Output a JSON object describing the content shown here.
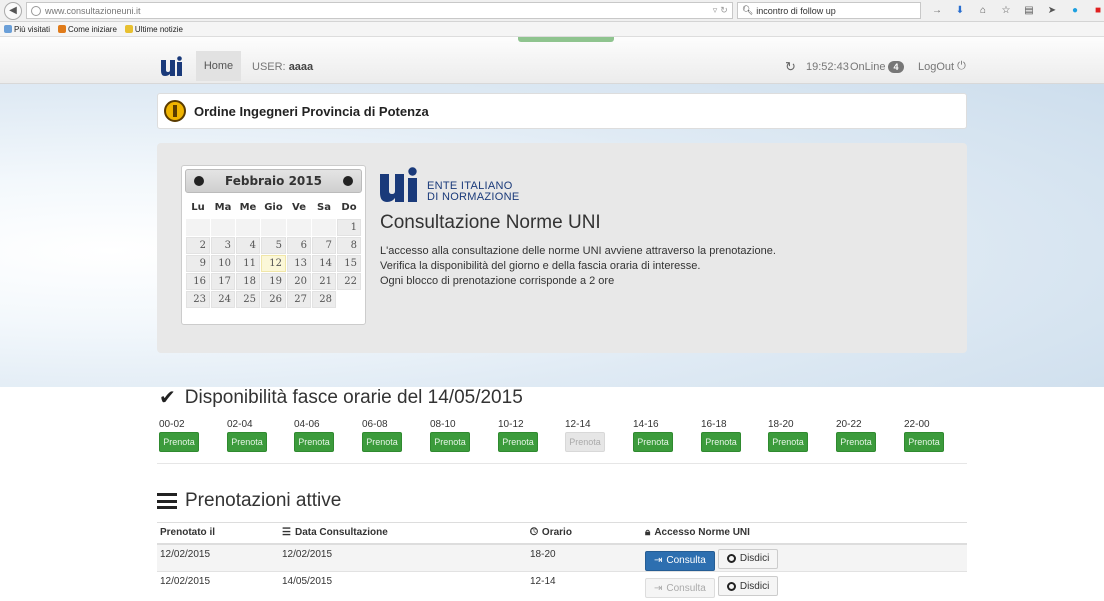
{
  "browser": {
    "url": "www.consultazioneuni.it",
    "search": "incontro di follow up",
    "bookmarks": [
      "Più visitati",
      "Come iniziare",
      "Ultime notizie"
    ]
  },
  "nav": {
    "home": "Home",
    "user_label": "USER:",
    "user_name": "aaaa",
    "time": "19:52:43",
    "online_label": "OnLine",
    "online_count": "4",
    "logout": "LogOut"
  },
  "org": {
    "title": "Ordine Ingegneri Provincia di Potenza"
  },
  "calendar": {
    "month": "Febbraio 2015",
    "weekdays": [
      "Lu",
      "Ma",
      "Me",
      "Gio",
      "Ve",
      "Sa",
      "Do"
    ],
    "weeks": [
      [
        "",
        "",
        "",
        "",
        "",
        "",
        "1"
      ],
      [
        "2",
        "3",
        "4",
        "5",
        "6",
        "7",
        "8"
      ],
      [
        "9",
        "10",
        "11",
        "12",
        "13",
        "14",
        "15"
      ],
      [
        "16",
        "17",
        "18",
        "19",
        "20",
        "21",
        "22"
      ],
      [
        "23",
        "24",
        "25",
        "26",
        "27",
        "28",
        ""
      ]
    ],
    "today": "12"
  },
  "uni": {
    "line1": "ENTE ITALIANO",
    "line2": "DI NORMAZIONE",
    "title": "Consultazione Norme UNI",
    "text1": "L'accesso alla consultazione delle norme UNI avviene attraverso la prenotazione.",
    "text2": "Verifica la disponibilità del giorno e della fascia oraria di interesse.",
    "text3": "Ogni blocco di prenotazione corrisponde a 2 ore"
  },
  "availability": {
    "title": "Disponibilità fasce orarie del 14/05/2015",
    "button_label": "Prenota",
    "slots": [
      {
        "label": "00-02",
        "available": true
      },
      {
        "label": "02-04",
        "available": true
      },
      {
        "label": "04-06",
        "available": true
      },
      {
        "label": "06-08",
        "available": true
      },
      {
        "label": "08-10",
        "available": true
      },
      {
        "label": "10-12",
        "available": true
      },
      {
        "label": "12-14",
        "available": false
      },
      {
        "label": "14-16",
        "available": true
      },
      {
        "label": "16-18",
        "available": true
      },
      {
        "label": "18-20",
        "available": true
      },
      {
        "label": "20-22",
        "available": true
      },
      {
        "label": "22-00",
        "available": true
      }
    ]
  },
  "bookings": {
    "title": "Prenotazioni attive",
    "headers": [
      "Prenotato il",
      "Data Consultazione",
      "Orario",
      "Accesso Norme UNI"
    ],
    "consulta_label": "Consulta",
    "disdici_label": "Disdici",
    "rows": [
      {
        "booked": "12/02/2015",
        "date": "12/02/2015",
        "slot": "18-20",
        "consulta_enabled": true
      },
      {
        "booked": "12/02/2015",
        "date": "14/05/2015",
        "slot": "12-14",
        "consulta_enabled": false
      }
    ]
  },
  "colors": {
    "primary": "#2d6fb0",
    "success": "#3c9b3c",
    "uni_blue": "#1a3a7a"
  }
}
